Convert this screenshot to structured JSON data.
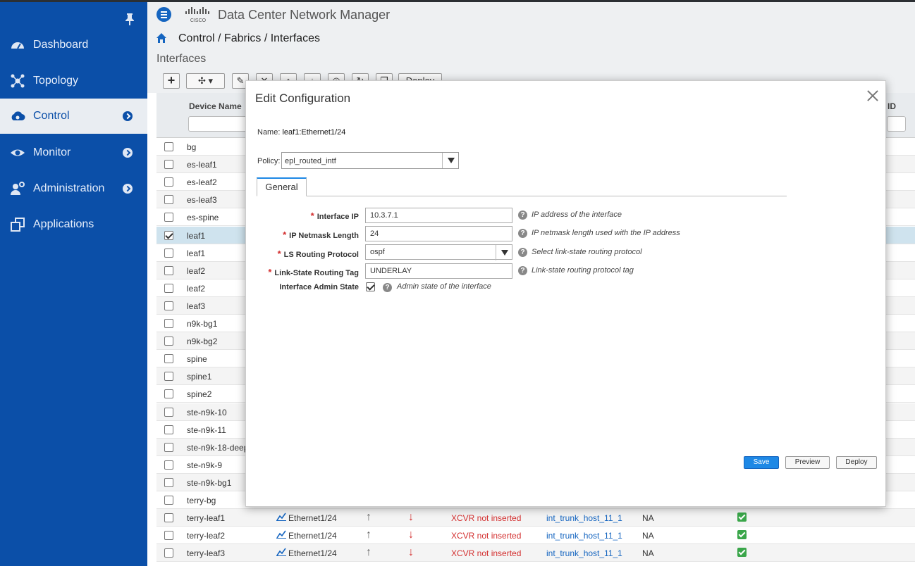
{
  "app": {
    "title": "Data Center Network Manager"
  },
  "sidebar": {
    "items": [
      {
        "label": "Dashboard",
        "icon": "dashboard-icon",
        "has_submenu": false
      },
      {
        "label": "Topology",
        "icon": "topology-icon",
        "has_submenu": false
      },
      {
        "label": "Control",
        "icon": "control-icon",
        "has_submenu": true,
        "active": true
      },
      {
        "label": "Monitor",
        "icon": "monitor-icon",
        "has_submenu": true
      },
      {
        "label": "Administration",
        "icon": "administration-icon",
        "has_submenu": true
      },
      {
        "label": "Applications",
        "icon": "applications-icon",
        "has_submenu": false
      }
    ]
  },
  "breadcrumb": "Control / Fabrics / Interfaces",
  "section_title": "Interfaces",
  "toolbar": {
    "deploy_label": "Deploy"
  },
  "table": {
    "headers": {
      "device_name": "Device Name",
      "id": "ID"
    },
    "rows": [
      {
        "device": "bg"
      },
      {
        "device": "es-leaf1"
      },
      {
        "device": "es-leaf2"
      },
      {
        "device": "es-leaf3"
      },
      {
        "device": "es-spine"
      },
      {
        "device": "leaf1",
        "selected": true
      },
      {
        "device": "leaf1"
      },
      {
        "device": "leaf2"
      },
      {
        "device": "leaf2"
      },
      {
        "device": "leaf3"
      },
      {
        "device": "n9k-bg1"
      },
      {
        "device": "n9k-bg2"
      },
      {
        "device": "spine"
      },
      {
        "device": "spine1"
      },
      {
        "device": "spine2"
      },
      {
        "device": "ste-n9k-10"
      },
      {
        "device": "ste-n9k-11"
      },
      {
        "device": "ste-n9k-18-deep"
      },
      {
        "device": "ste-n9k-9"
      },
      {
        "device": "ste-n9k-bg1"
      },
      {
        "device": "terry-bg"
      },
      {
        "device": "terry-leaf1",
        "interface": "Ethernet1/24",
        "reason": "XCVR not inserted",
        "policy": "int_trunk_host_11_1",
        "na": "NA"
      },
      {
        "device": "terry-leaf2",
        "interface": "Ethernet1/24",
        "reason": "XCVR not inserted",
        "policy": "int_trunk_host_11_1",
        "na": "NA"
      },
      {
        "device": "terry-leaf3",
        "interface": "Ethernet1/24",
        "reason": "XCVR not inserted",
        "policy": "int_trunk_host_11_1",
        "na": "NA"
      }
    ]
  },
  "modal": {
    "title": "Edit Configuration",
    "name_label": "Name:",
    "name_value": "leaf1:Ethernet1/24",
    "policy_label": "Policy:",
    "policy_value": "epl_routed_intf",
    "tab_general": "General",
    "fields": [
      {
        "label": "Interface IP",
        "required": true,
        "value": "10.3.7.1",
        "help": "IP address of the interface"
      },
      {
        "label": "IP Netmask Length",
        "required": true,
        "value": "24",
        "help": "IP netmask length used with the IP address"
      },
      {
        "label": "LS Routing Protocol",
        "required": true,
        "value": "ospf",
        "help": "Select link-state routing protocol",
        "type": "select"
      },
      {
        "label": "Link-State Routing Tag",
        "required": true,
        "value": "UNDERLAY",
        "help": "Link-state routing protocol tag"
      }
    ],
    "admin_state": {
      "label": "Interface Admin State",
      "checked": true,
      "help": "Admin state of the interface"
    },
    "buttons": {
      "save": "Save",
      "preview": "Preview",
      "deploy": "Deploy"
    }
  },
  "colors": {
    "sidebar": "#0b4fa8",
    "accent": "#1e88e5",
    "error": "#d32f2f",
    "success": "#3aa64a"
  }
}
